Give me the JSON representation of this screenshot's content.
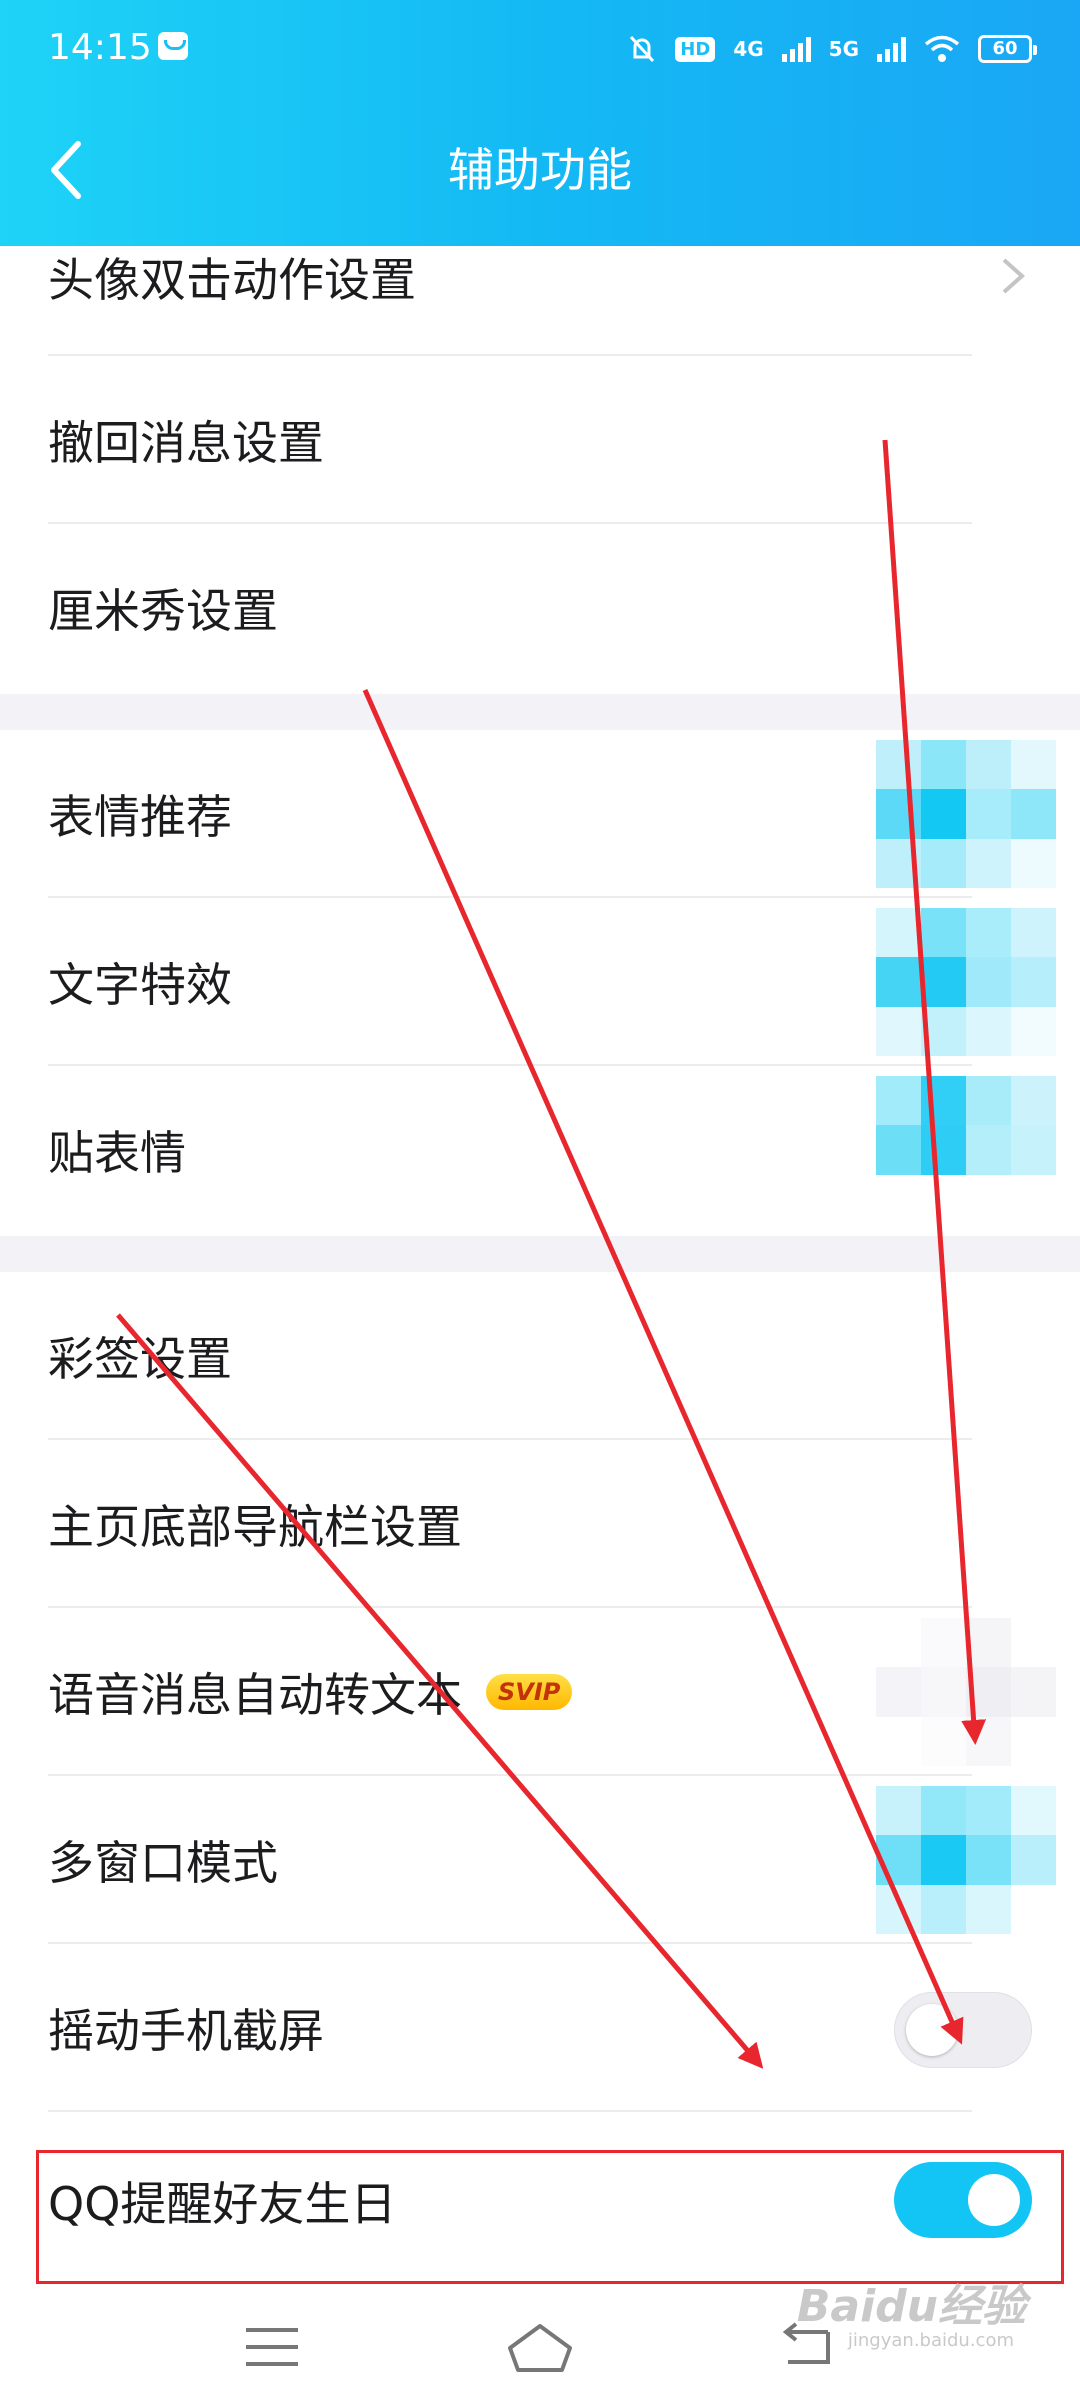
{
  "status_bar": {
    "time": "14:15",
    "signal_4g": "4G",
    "signal_5g": "5G",
    "hd_label": "HD",
    "battery": "60"
  },
  "header": {
    "title": "辅助功能"
  },
  "groups": [
    {
      "items": [
        {
          "label": "头像双击动作设置"
        },
        {
          "label": "撤回消息设置"
        },
        {
          "label": "厘米秀设置"
        }
      ]
    },
    {
      "items": [
        {
          "label": "表情推荐"
        },
        {
          "label": "文字特效"
        },
        {
          "label": "贴表情"
        }
      ]
    },
    {
      "items": [
        {
          "label": "彩签设置"
        },
        {
          "label": "主页底部导航栏设置"
        },
        {
          "label": "语音消息自动转文本",
          "badge": "SVIP"
        },
        {
          "label": "多窗口模式"
        },
        {
          "label": "摇动手机截屏",
          "toggle": false
        },
        {
          "label": "QQ提醒好友生日",
          "toggle": true
        }
      ]
    }
  ],
  "watermark": {
    "text": "Baidu经验",
    "sub": "jingyan.baidu.com"
  },
  "colors": {
    "header_gradient_start": "#1ed3f7",
    "header_gradient_end": "#1aa7f5",
    "toggle_on": "#12c5f4",
    "annotation_red": "#e8262e",
    "svip_gold": "#ffc21a"
  },
  "icons": [
    "back-arrow-icon",
    "chevron-right-icon",
    "menu-icon",
    "home-icon",
    "back-nav-icon",
    "message-notification-icon",
    "mute-bell-icon",
    "wifi-icon",
    "battery-icon"
  ]
}
